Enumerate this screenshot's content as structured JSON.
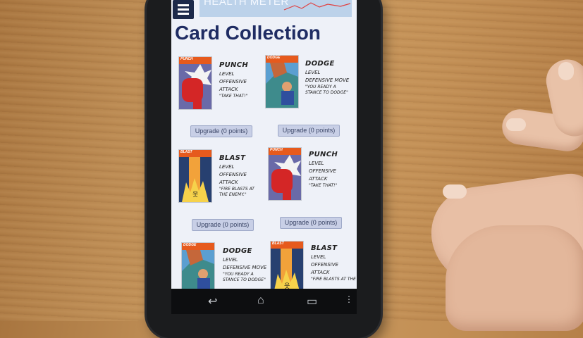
{
  "app": {
    "health_meter_label": "HEALTH METER",
    "page_title": "Card Collection"
  },
  "cards": [
    {
      "name": "PUNCH",
      "level": "LEVEL",
      "type": "OFFENSIVE",
      "kind": "ATTACK",
      "quote": "\"TAKE THAT!\"",
      "card_header": "PUNCH",
      "upgrade": "Upgrade (0 points)"
    },
    {
      "name": "DODGE",
      "level": "LEVEL",
      "type": "DEFENSIVE MOVE",
      "kind": "",
      "quote": "\"YOU READY A STANCE TO DODGE\"",
      "card_header": "DODGE",
      "upgrade": "Upgrade (0 points)"
    },
    {
      "name": "BLAST",
      "level": "LEVEL",
      "type": "OFFENSIVE",
      "kind": "ATTACK",
      "quote": "\"FIRE BLASTS AT THE ENEMY.\"",
      "card_header": "BLAST",
      "upgrade": "Upgrade (0 points)"
    },
    {
      "name": "PUNCH",
      "level": "LEVEL",
      "type": "OFFENSIVE",
      "kind": "ATTACK",
      "quote": "\"TAKE THAT!\"",
      "card_header": "PUNCH",
      "upgrade": "Upgrade (0 points)"
    },
    {
      "name": "DODGE",
      "level": "LEVEL",
      "type": "DEFENSIVE MOVE",
      "kind": "",
      "quote": "\"YOU READY A STANCE TO DODGE\"",
      "card_header": "DODGE",
      "upgrade": ""
    },
    {
      "name": "BLAST",
      "level": "LEVEL",
      "type": "OFFENSIVE",
      "kind": "ATTACK",
      "quote": "\"FIRE BLASTS AT THE",
      "card_header": "BLAST",
      "upgrade": ""
    }
  ],
  "nav": {
    "back": "↩",
    "home": "⌂",
    "recents": "▭",
    "more": "⋮"
  },
  "colors": {
    "title": "#1f2c63",
    "card_header": "#e65a1d",
    "menu": "#1d2a4a",
    "upgrade_bg": "#c8cfe6"
  }
}
